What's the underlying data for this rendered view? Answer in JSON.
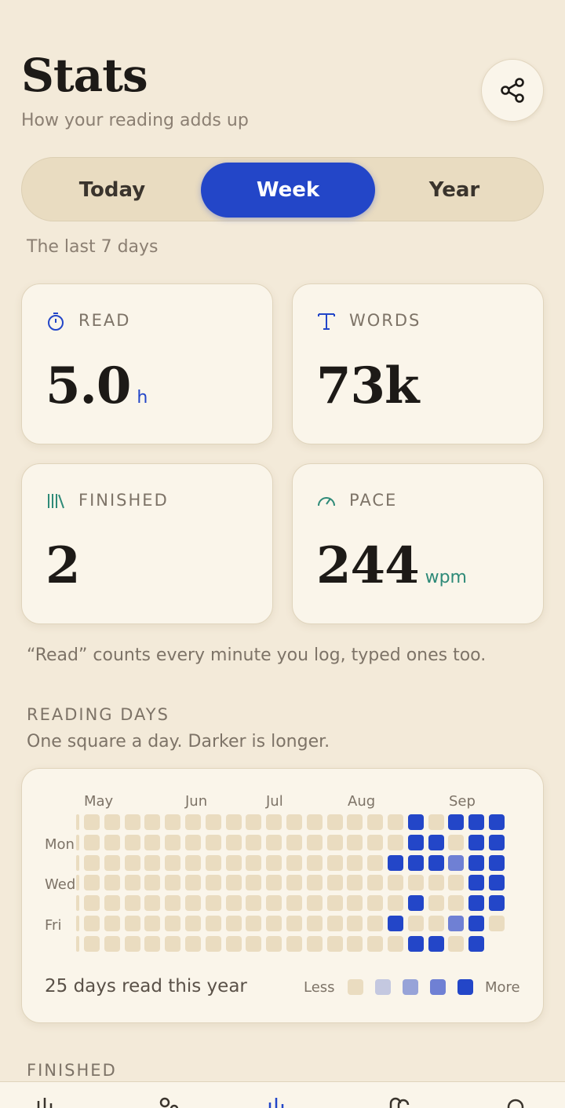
{
  "header": {
    "title": "Stats",
    "subtitle": "How your reading adds up",
    "share_icon": "share-icon"
  },
  "tabs": [
    {
      "label": "Today",
      "active": false
    },
    {
      "label": "Week",
      "active": true
    },
    {
      "label": "Year",
      "active": false
    }
  ],
  "range_note": "The last 7 days",
  "cards": {
    "read": {
      "label": "READ",
      "value": "5.0",
      "unit": "h",
      "icon": "stopwatch-icon",
      "unit_color": "#2346c8",
      "icon_color": "#2346c8"
    },
    "words": {
      "label": "WORDS",
      "value": "73k",
      "unit": "",
      "icon": "text-t-icon",
      "icon_color": "#2346c8"
    },
    "finished": {
      "label": "FINISHED",
      "value": "2",
      "unit": "",
      "icon": "books-icon",
      "icon_color": "#2e8a78"
    },
    "pace": {
      "label": "PACE",
      "value": "244",
      "unit": "wpm",
      "icon": "gauge-icon",
      "unit_color": "#2e8a78",
      "icon_color": "#2e8a78"
    }
  },
  "footnote": "“Read” counts every minute you log, typed ones too.",
  "reading_days": {
    "heading": "READING DAYS",
    "description": "One square a day. Darker is longer.",
    "months": [
      "May",
      "Jun",
      "Jul",
      "Aug",
      "Sep"
    ],
    "day_labels": [
      "Mon",
      "Wed",
      "Fri"
    ],
    "summary": "25 days read this year",
    "legend_less": "Less",
    "legend_more": "More",
    "levels": [
      "#eadcc0",
      "#c4c8e0",
      "#97a3d8",
      "#6f80d4",
      "#2346c8"
    ],
    "active_cells": [
      {
        "week": 16,
        "day": 0,
        "level": 4
      },
      {
        "week": 18,
        "day": 0,
        "level": 4
      },
      {
        "week": 19,
        "day": 0,
        "level": 4
      },
      {
        "week": 20,
        "day": 0,
        "level": 4
      },
      {
        "week": 16,
        "day": 1,
        "level": 4
      },
      {
        "week": 17,
        "day": 1,
        "level": 4
      },
      {
        "week": 19,
        "day": 1,
        "level": 4
      },
      {
        "week": 20,
        "day": 1,
        "level": 4
      },
      {
        "week": 15,
        "day": 2,
        "level": 4
      },
      {
        "week": 16,
        "day": 2,
        "level": 4
      },
      {
        "week": 17,
        "day": 2,
        "level": 4
      },
      {
        "week": 18,
        "day": 2,
        "level": 3
      },
      {
        "week": 19,
        "day": 2,
        "level": 4
      },
      {
        "week": 20,
        "day": 2,
        "level": 4
      },
      {
        "week": 19,
        "day": 3,
        "level": 4
      },
      {
        "week": 20,
        "day": 3,
        "level": 4
      },
      {
        "week": 16,
        "day": 4,
        "level": 4
      },
      {
        "week": 19,
        "day": 4,
        "level": 4
      },
      {
        "week": 20,
        "day": 4,
        "level": 4
      },
      {
        "week": 15,
        "day": 5,
        "level": 4
      },
      {
        "week": 18,
        "day": 5,
        "level": 3
      },
      {
        "week": 19,
        "day": 5,
        "level": 4
      },
      {
        "week": 16,
        "day": 6,
        "level": 4
      },
      {
        "week": 17,
        "day": 6,
        "level": 4
      },
      {
        "week": 19,
        "day": 6,
        "level": 4
      }
    ]
  },
  "finished_heading": "FINISHED",
  "nav_icons": [
    "chart-icon",
    "nodes-icon",
    "stats-icon",
    "link-icon",
    "search-icon"
  ],
  "colors": {
    "accent": "#2346c8",
    "teal": "#2e8a78",
    "background": "#f3ead9",
    "card": "#faf5ea"
  }
}
